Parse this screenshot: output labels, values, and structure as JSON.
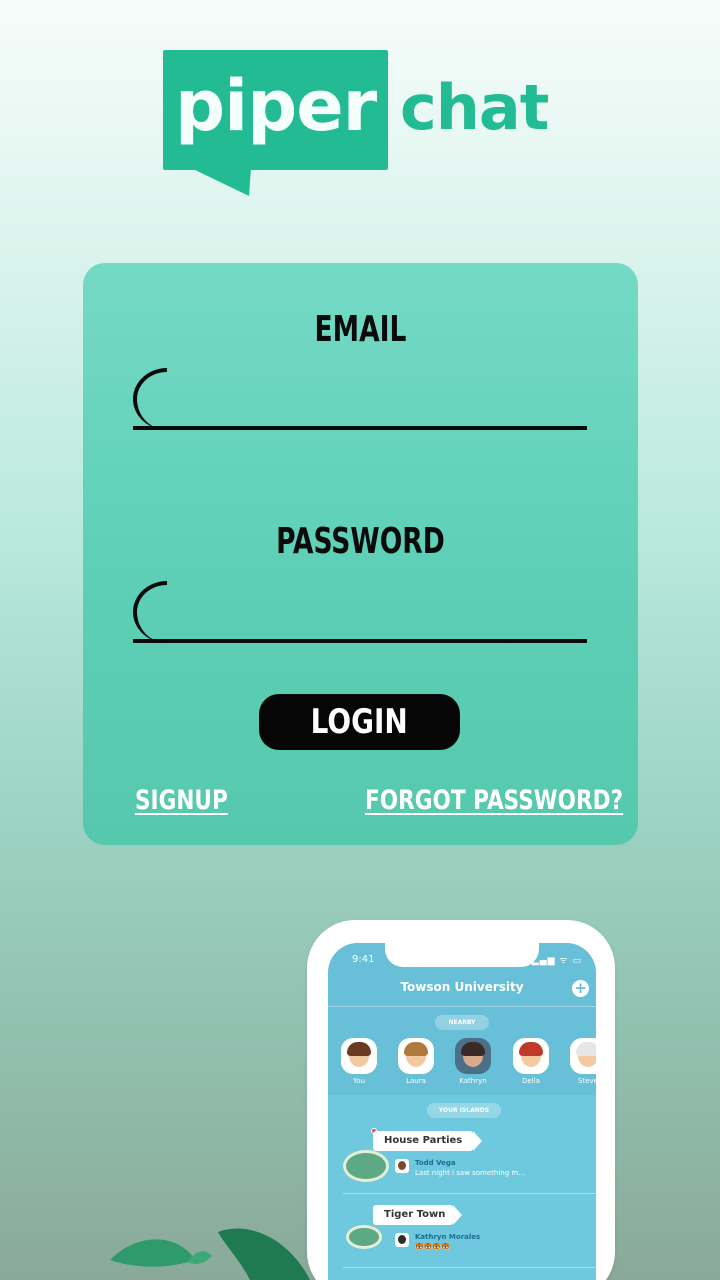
{
  "logo": {
    "part1": "piper",
    "part2": "chat"
  },
  "colors": {
    "brand": "#22bb94",
    "card": "#5dcfb6",
    "button": "#060606"
  },
  "form": {
    "email_label": "EMAIL",
    "email_value": "",
    "password_label": "PASSWORD",
    "password_value": "",
    "login_label": "LOGIN",
    "signup_label": "SIGNUP",
    "forgot_label": "FORGOT PASSWORD?"
  },
  "phone": {
    "time": "9:41",
    "status_icons": "▂▄▆ ᯤ ▭",
    "title": "Towson University",
    "add_icon": "+",
    "nearby_label": "NEARBY",
    "avatars": [
      {
        "name": "You",
        "hair": "#6b3a22"
      },
      {
        "name": "Laura",
        "hair": "#b07a3c"
      },
      {
        "name": "Kathryn",
        "hair": "#3a2a25"
      },
      {
        "name": "Della",
        "hair": "#c0392b"
      },
      {
        "name": "Steve",
        "hair": "#e6e6e6"
      }
    ],
    "islands_label": "YOUR ISLANDS",
    "islands": [
      {
        "name": "House Parties",
        "author": "Todd Vega",
        "message": "Last night i saw something m..."
      },
      {
        "name": "Tiger Town",
        "author": "Kathryn Morales",
        "message": "🐯🐯🐯🐯"
      }
    ]
  }
}
